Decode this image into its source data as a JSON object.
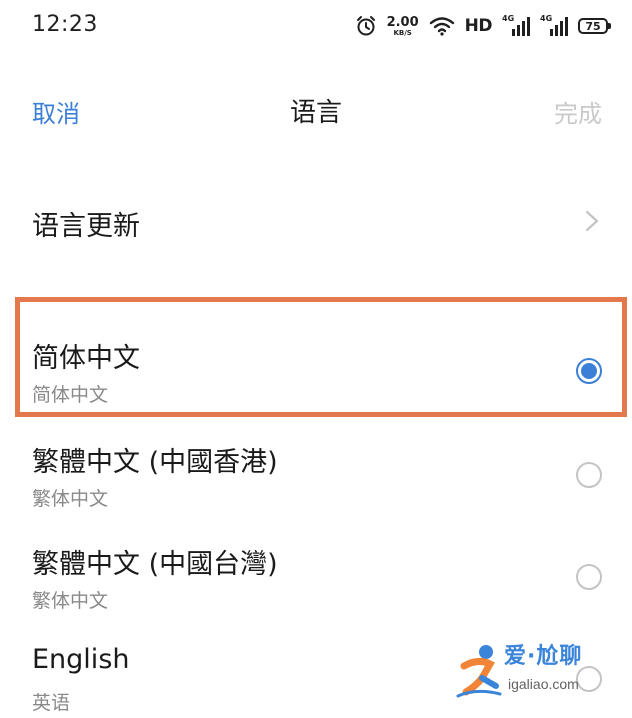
{
  "status_bar": {
    "time": "12:23",
    "net_speed_value": "2.00",
    "net_speed_unit": "KB/S",
    "hd_label": "HD",
    "signal1_tag": "4G",
    "signal2_tag": "4G",
    "battery": "75",
    "icons": [
      "alarm-icon",
      "wifi-icon",
      "signal-icon",
      "signal-icon",
      "battery-icon"
    ]
  },
  "nav": {
    "cancel_label": "取消",
    "title": "语言",
    "done_label": "完成",
    "colors": {
      "accent": "#3c7fd6",
      "done_disabled": "#c9c9c9"
    }
  },
  "update_row": {
    "label": "语言更新",
    "icon": "chevron-right-icon"
  },
  "languages": [
    {
      "name": "简体中文",
      "sub": "简体中文",
      "selected": true
    },
    {
      "name": "繁體中文 (中國香港)",
      "sub": "繁体中文",
      "selected": false
    },
    {
      "name": "繁體中文 (中國台灣)",
      "sub": "繁体中文",
      "selected": false
    },
    {
      "name": "English",
      "sub": "英语",
      "selected": false
    }
  ],
  "annotation": {
    "highlight_color": "#e3784d"
  },
  "watermark": {
    "brand": "爱·尬聊",
    "url": "igaliao.com"
  }
}
